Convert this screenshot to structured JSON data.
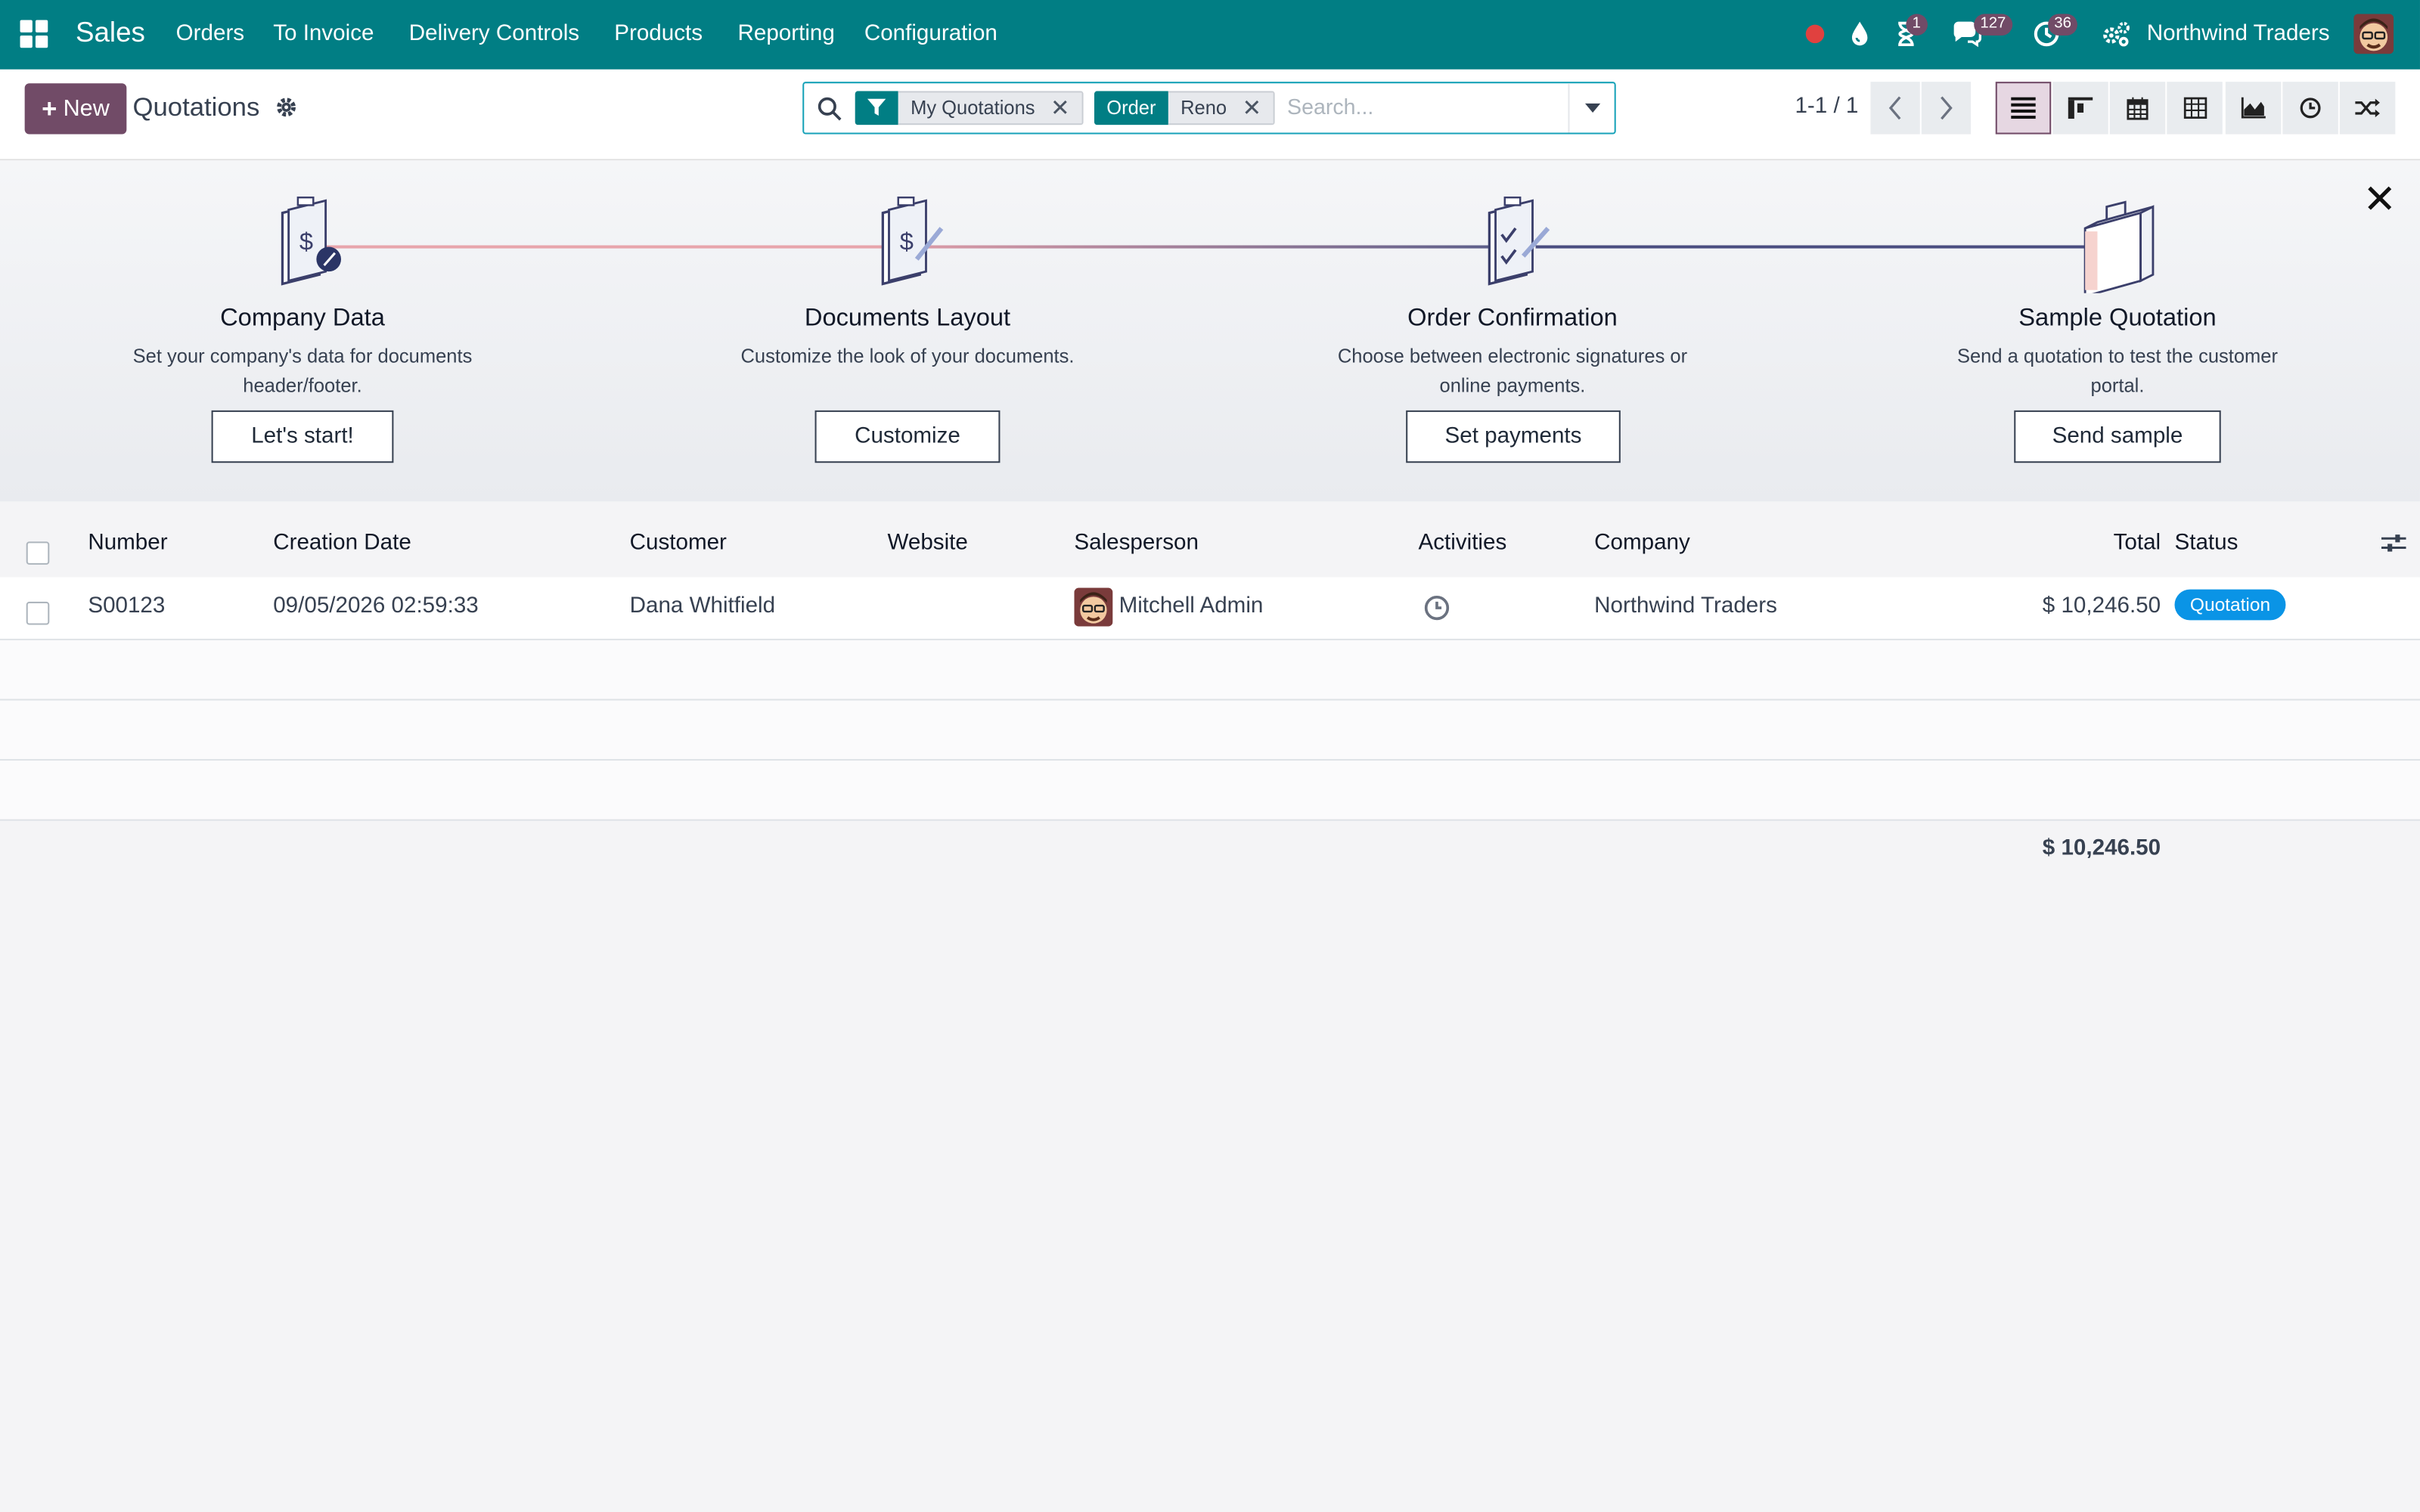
{
  "navbar": {
    "app_name": "Sales",
    "menus": [
      "Orders",
      "To Invoice",
      "Delivery Controls",
      "Products",
      "Reporting",
      "Configuration"
    ],
    "activity_badge": "1",
    "messages_badge": "127",
    "timesheet_badge": "36",
    "company": "Northwind Traders"
  },
  "control": {
    "new_label": "New",
    "breadcrumb": "Quotations",
    "facets": [
      {
        "tag": "filter-icon",
        "value": "My Quotations"
      },
      {
        "tag": "Order",
        "value": "Reno"
      }
    ],
    "search_placeholder": "Search...",
    "pager_value": "1-1 / 1",
    "views": [
      "list-icon",
      "kanban-icon",
      "calendar-icon",
      "pivot-icon",
      "graph-icon",
      "activity-icon",
      "cohort-icon"
    ]
  },
  "onboarding": {
    "steps": [
      {
        "title": "Company Data",
        "description": "Set your company's data for documents header/footer.",
        "button": "Let's start!"
      },
      {
        "title": "Documents Layout",
        "description": "Customize the look of your documents.",
        "button": "Customize"
      },
      {
        "title": "Order Confirmation",
        "description": "Choose between electronic signatures or online payments.",
        "button": "Set payments"
      },
      {
        "title": "Sample Quotation",
        "description": "Send a quotation to test the customer portal.",
        "button": "Send sample"
      }
    ]
  },
  "list": {
    "columns": [
      "Number",
      "Creation Date",
      "Customer",
      "Website",
      "Salesperson",
      "Activities",
      "Company",
      "Total",
      "Status"
    ],
    "rows": [
      {
        "number": "S00123",
        "creation_date": "09/05/2026 02:59:33",
        "customer": "Dana Whitfield",
        "website": "",
        "salesperson": "Mitchell Admin",
        "company": "Northwind Traders",
        "total": "$ 10,246.50",
        "status": "Quotation"
      }
    ],
    "grand_total": "$ 10,246.50"
  },
  "colors": {
    "navbar": "#017e84",
    "primary": "#714b67",
    "status_quotation": "#0a94e6"
  }
}
